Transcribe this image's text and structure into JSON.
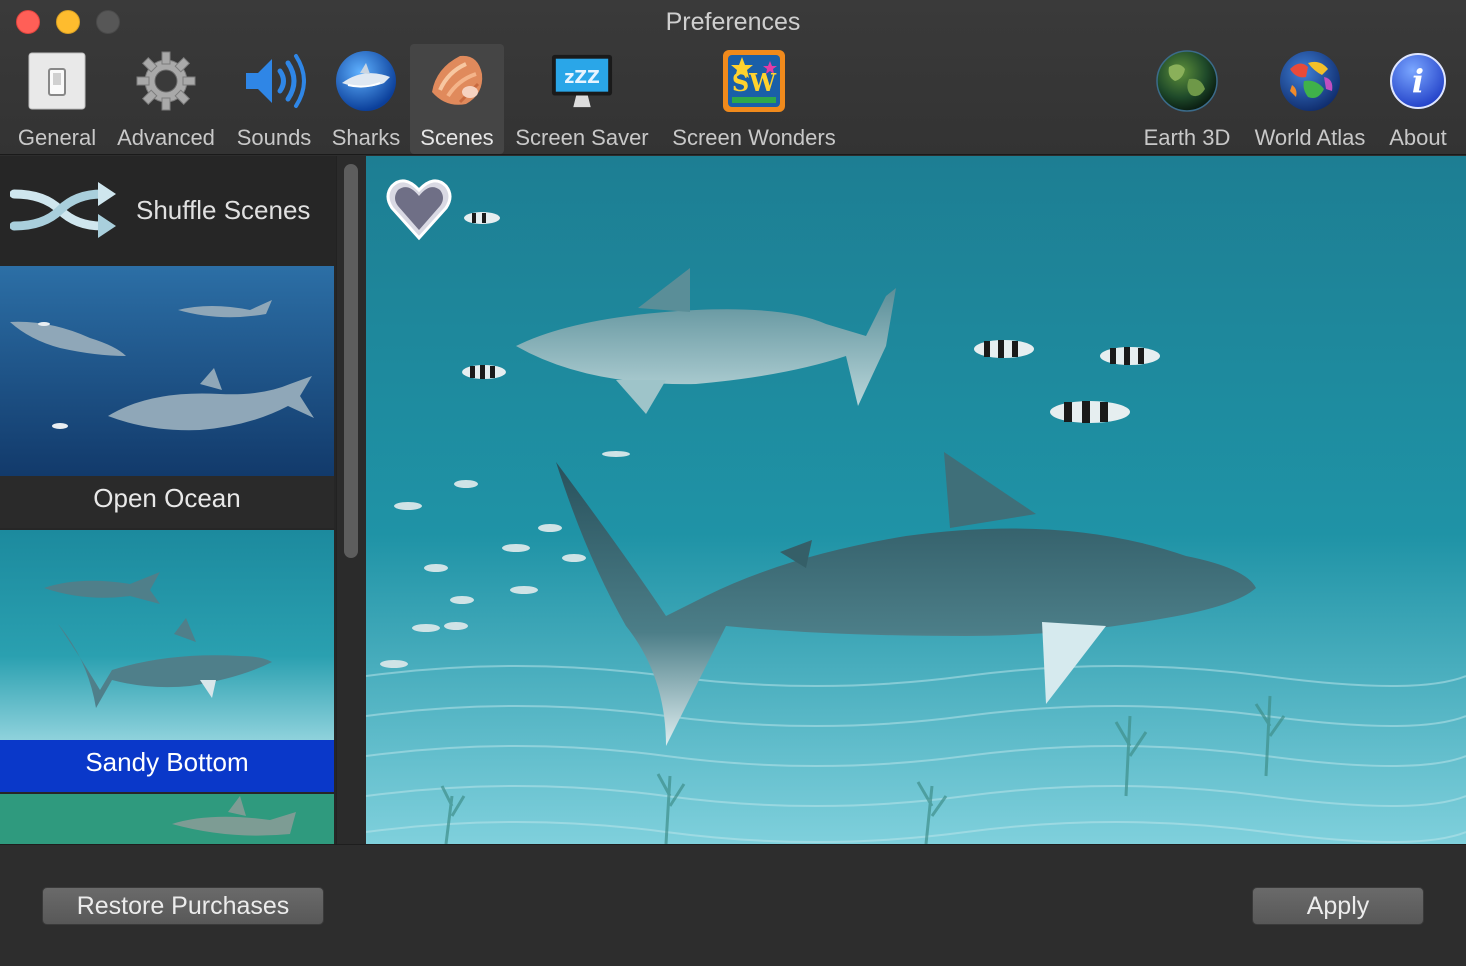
{
  "window": {
    "title": "Preferences"
  },
  "toolbar": {
    "items": [
      {
        "label": "General",
        "icon": "general-switch-icon"
      },
      {
        "label": "Advanced",
        "icon": "gear-icon"
      },
      {
        "label": "Sounds",
        "icon": "speaker-icon"
      },
      {
        "label": "Sharks",
        "icon": "shark-icon"
      },
      {
        "label": "Scenes",
        "icon": "conch-shell-icon",
        "selected": true
      },
      {
        "label": "Screen Saver",
        "icon": "screen-saver-icon"
      },
      {
        "label": "Screen Wonders",
        "icon": "screen-wonders-icon"
      },
      {
        "label": "Earth 3D",
        "icon": "earth-globe-icon"
      },
      {
        "label": "World Atlas",
        "icon": "world-atlas-icon"
      },
      {
        "label": "About",
        "icon": "info-icon"
      }
    ]
  },
  "sidebar": {
    "shuffle_label": "Shuffle Scenes",
    "scenes": [
      {
        "label": "Open Ocean",
        "selected": false
      },
      {
        "label": "Sandy Bottom",
        "selected": true
      }
    ]
  },
  "buttons": {
    "restore": "Restore Purchases",
    "apply": "Apply"
  },
  "colors": {
    "selection": "#0a38c9",
    "ocean": "#1d8ea0",
    "deep_ocean": "#1f4f86"
  }
}
